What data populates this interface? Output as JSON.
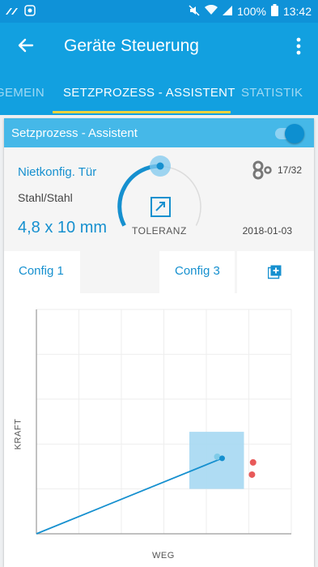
{
  "status_bar": {
    "battery": "100%",
    "time": "13:42",
    "icons": [
      "signal-icon",
      "notification-icon",
      "mute-icon",
      "wifi-icon",
      "cell-signal-icon",
      "battery-icon"
    ]
  },
  "app_bar": {
    "title": "Geräte Steuerung",
    "back_icon": "arrow-left-icon",
    "menu_icon": "more-vert-icon"
  },
  "tabs": [
    {
      "label": "GEMEIN",
      "active": false
    },
    {
      "label": "SETZPROZESS - ASSISTENT",
      "active": true
    },
    {
      "label": "STATISTIK",
      "active": false
    }
  ],
  "card": {
    "title": "Setzprozess - Assistent",
    "toggle_on": true
  },
  "info": {
    "part_name": "Nietkonfig. Tür",
    "material": "Stahl/Stahl",
    "dimension": "4,8 x 10 mm",
    "tolerance_label": "TOLERANZ",
    "counter": "17/32",
    "date": "2018-01-03"
  },
  "configs": [
    {
      "label": "Config 1"
    },
    {
      "label": "Config 3"
    }
  ],
  "colors": {
    "primary": "#12a0e0",
    "accent": "#1690cf",
    "header": "#45b8e8",
    "indicator": "#f2d23c",
    "tolerance_box": "#a6d8f2",
    "outlier": "#e85a5a"
  },
  "chart_data": {
    "type": "line",
    "xlabel": "WEG",
    "ylabel": "KRAFT",
    "grid": true,
    "xlim": [
      0,
      7
    ],
    "ylim": [
      0,
      5.5
    ],
    "series": [
      {
        "x": [
          0,
          5.1
        ],
        "y": [
          0,
          1.85
        ]
      }
    ],
    "tolerance_window": {
      "x": [
        4.2,
        5.7
      ],
      "y": [
        1.1,
        2.5
      ]
    },
    "outliers": {
      "x": [
        5.95,
        5.92
      ],
      "y": [
        1.75,
        1.45
      ]
    }
  }
}
